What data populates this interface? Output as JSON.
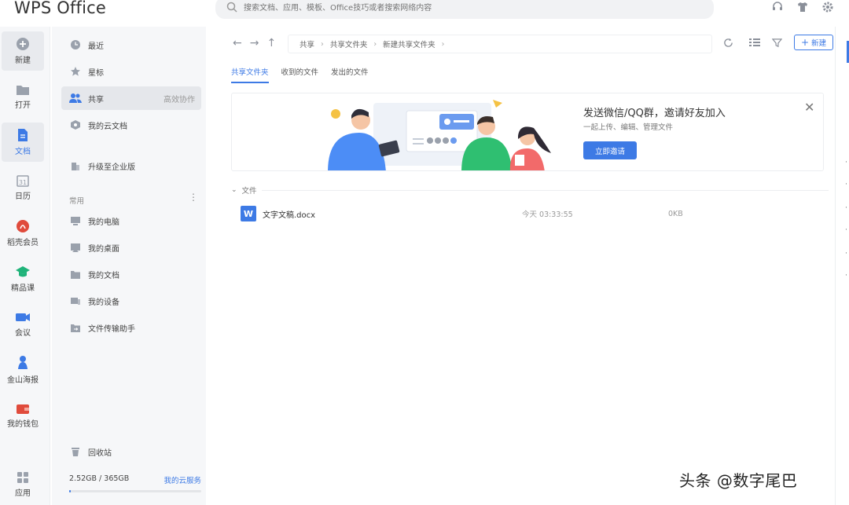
{
  "app": {
    "title": "WPS Office"
  },
  "search": {
    "placeholder": "搜索文档、应用、模板、Office技巧或者搜索网络内容"
  },
  "rail": {
    "items": [
      {
        "label": "新建",
        "icon": "plus-circle-icon"
      },
      {
        "label": "打开",
        "icon": "folder-icon"
      },
      {
        "label": "文档",
        "icon": "document-icon"
      },
      {
        "label": "日历",
        "icon": "calendar-icon"
      },
      {
        "label": "稻壳会员",
        "icon": "docer-icon"
      },
      {
        "label": "精品课",
        "icon": "graduation-cap-icon"
      },
      {
        "label": "会议",
        "icon": "video-icon"
      },
      {
        "label": "金山海报",
        "icon": "poster-icon"
      },
      {
        "label": "我的钱包",
        "icon": "wallet-icon"
      },
      {
        "label": "应用",
        "icon": "apps-grid-icon"
      }
    ]
  },
  "nav": {
    "recent": "最近",
    "starred": "星标",
    "shared": "共享",
    "shared_extra": "高效协作",
    "cloud_docs": "我的云文档",
    "upgrade": "升级至企业版",
    "common_section": "常用",
    "common_items": [
      "我的电脑",
      "我的桌面",
      "我的文档",
      "我的设备",
      "文件传输助手"
    ],
    "trash": "回收站",
    "storage_used": "2.52GB / 365GB",
    "storage_link": "我的云服务",
    "storage_fraction": 0.007
  },
  "toolbar": {
    "breadcrumb": [
      "共享",
      "共享文件夹",
      "新建共享文件夹"
    ],
    "new_label": "新建"
  },
  "tabs": [
    "共享文件夹",
    "收到的文件",
    "发出的文件"
  ],
  "banner": {
    "title": "发送微信/QQ群，邀请好友加入",
    "subtitle": "一起上传、编辑、管理文件",
    "button": "立即邀请"
  },
  "files": {
    "section_label": "文件",
    "rows": [
      {
        "name": "文字文稿.docx",
        "time": "今天 03:33:55",
        "size": "0KB"
      }
    ]
  },
  "watermark": "头条 @数字尾巴",
  "colors": {
    "accent": "#3d7ae5",
    "rail_bg": "#f6f7f9"
  }
}
